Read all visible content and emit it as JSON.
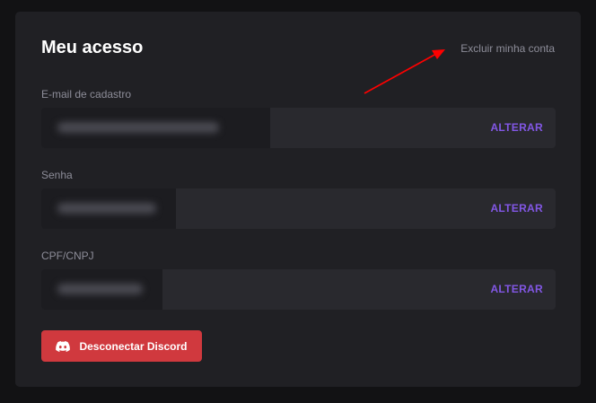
{
  "section": {
    "title": "Meu acesso",
    "delete_account_label": "Excluir minha conta"
  },
  "fields": {
    "email": {
      "label": "E-mail de cadastro",
      "action_label": "ALTERAR"
    },
    "password": {
      "label": "Senha",
      "action_label": "ALTERAR"
    },
    "document": {
      "label": "CPF/CNPJ",
      "action_label": "ALTERAR"
    }
  },
  "discord": {
    "button_label": "Desconectar Discord",
    "icon": "discord-icon"
  },
  "colors": {
    "accent": "#8257e5",
    "danger": "#d0393e",
    "annotation_arrow": "#ff0000"
  }
}
